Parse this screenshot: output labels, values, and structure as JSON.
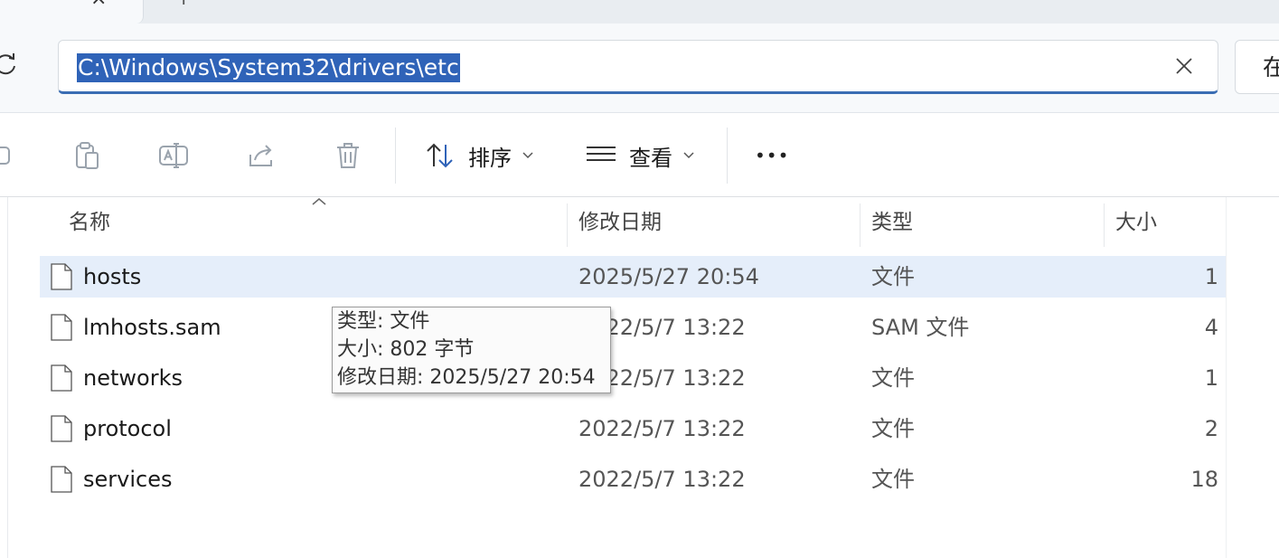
{
  "window": {
    "tab_close_glyph": "×",
    "new_tab_glyph": "+"
  },
  "address": {
    "path": "C:\\Windows\\System32\\drivers\\etc",
    "search_partial": "在"
  },
  "toolbar": {
    "sort_label": "排序",
    "view_label": "查看",
    "more_label": "•••"
  },
  "columns": {
    "name": "名称",
    "modified": "修改日期",
    "type": "类型",
    "size": "大小"
  },
  "files": [
    {
      "name": "hosts",
      "modified": "2025/5/27 20:54",
      "type": "文件",
      "size": "1",
      "selected": true
    },
    {
      "name": "lmhosts.sam",
      "modified": "2022/5/7 13:22",
      "type": "SAM 文件",
      "size": "4",
      "selected": false
    },
    {
      "name": "networks",
      "modified": "2022/5/7 13:22",
      "type": "文件",
      "size": "1",
      "selected": false
    },
    {
      "name": "protocol",
      "modified": "2022/5/7 13:22",
      "type": "文件",
      "size": "2",
      "selected": false
    },
    {
      "name": "services",
      "modified": "2022/5/7 13:22",
      "type": "文件",
      "size": "18",
      "selected": false
    }
  ],
  "tooltip": {
    "line1": "类型: 文件",
    "line2": "大小: 802 字节",
    "line3": "修改日期: 2025/5/27 20:54"
  },
  "colors": {
    "accent": "#2f63b8",
    "selected_row": "#e5eefa"
  }
}
